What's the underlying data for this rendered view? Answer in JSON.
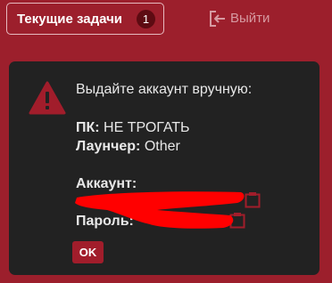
{
  "header": {
    "tasks_label": "Текущие задачи",
    "tasks_count": "1",
    "logout_label": "Выйти"
  },
  "dialog": {
    "title": "Выдайте аккаунт вручную:",
    "pc_label": "ПК:",
    "pc_value": "НЕ ТРОГАТЬ",
    "launcher_label": "Лаунчер:",
    "launcher_value": "Other",
    "account_label": "Аккаунт:",
    "password_label": "Пароль:",
    "ok_label": "OK"
  },
  "icons": {
    "warning": "warning-icon",
    "logout": "logout-icon",
    "copy": "copy-icon"
  },
  "colors": {
    "header_bg": "#9c1f2c",
    "dialog_bg": "#222222",
    "accent": "#a11d2b",
    "redaction": "#ff0000"
  }
}
